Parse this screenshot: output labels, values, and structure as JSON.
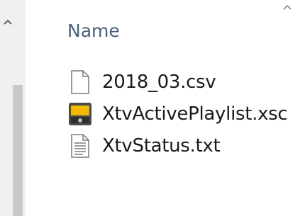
{
  "header": {
    "name_column": "Name"
  },
  "files": [
    {
      "name": "2018_03.csv",
      "icon": "blank-document-icon"
    },
    {
      "name": "XtvActivePlaylist.xsc",
      "icon": "media-file-icon"
    },
    {
      "name": "XtvStatus.txt",
      "icon": "text-document-icon"
    }
  ],
  "colors": {
    "header_text": "#4c607a",
    "file_text": "#1a1a1a",
    "media_icon_fill": "#f5b800"
  }
}
